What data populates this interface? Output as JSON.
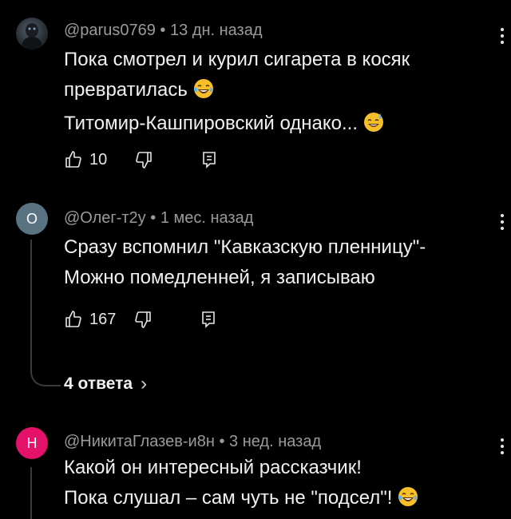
{
  "comments": [
    {
      "author": "@parus0769",
      "separator": "•",
      "time": "13 дн. назад",
      "lines": [
        "Пока смотрел и курил сигарета в косяк",
        "превратилась",
        "Титомир-Кашпировский однако..."
      ],
      "emojis": [
        "laughing-tears",
        "sweat-smile"
      ],
      "likes": "10",
      "avatar_letter": "",
      "avatar_color": "#2a3038"
    },
    {
      "author": "@Олег-т2у",
      "separator": "•",
      "time": "1 мес. назад",
      "lines": [
        "Сразу вспомнил \"Кавказскую пленницу\"-",
        "Можно помедленней, я записываю"
      ],
      "likes": "167",
      "avatar_letter": "О",
      "avatar_color": "#5a7382",
      "replies_label": "4 ответа",
      "replies_chevron": "›"
    },
    {
      "author": "@НикитаГлазев-и8н",
      "separator": "•",
      "time": "3 нед. назад",
      "lines": [
        "Какой он интересный рассказчик!",
        "Пока слушал – сам чуть не \"подсел\"!"
      ],
      "emojis": [
        "laughing-tears"
      ],
      "avatar_letter": "Н",
      "avatar_color": "#e5126a"
    }
  ],
  "colors": {
    "background": "#000000",
    "meta": "#9a9a9a",
    "text": "#f1f1f1",
    "thread_line": "#3a3a3a"
  }
}
